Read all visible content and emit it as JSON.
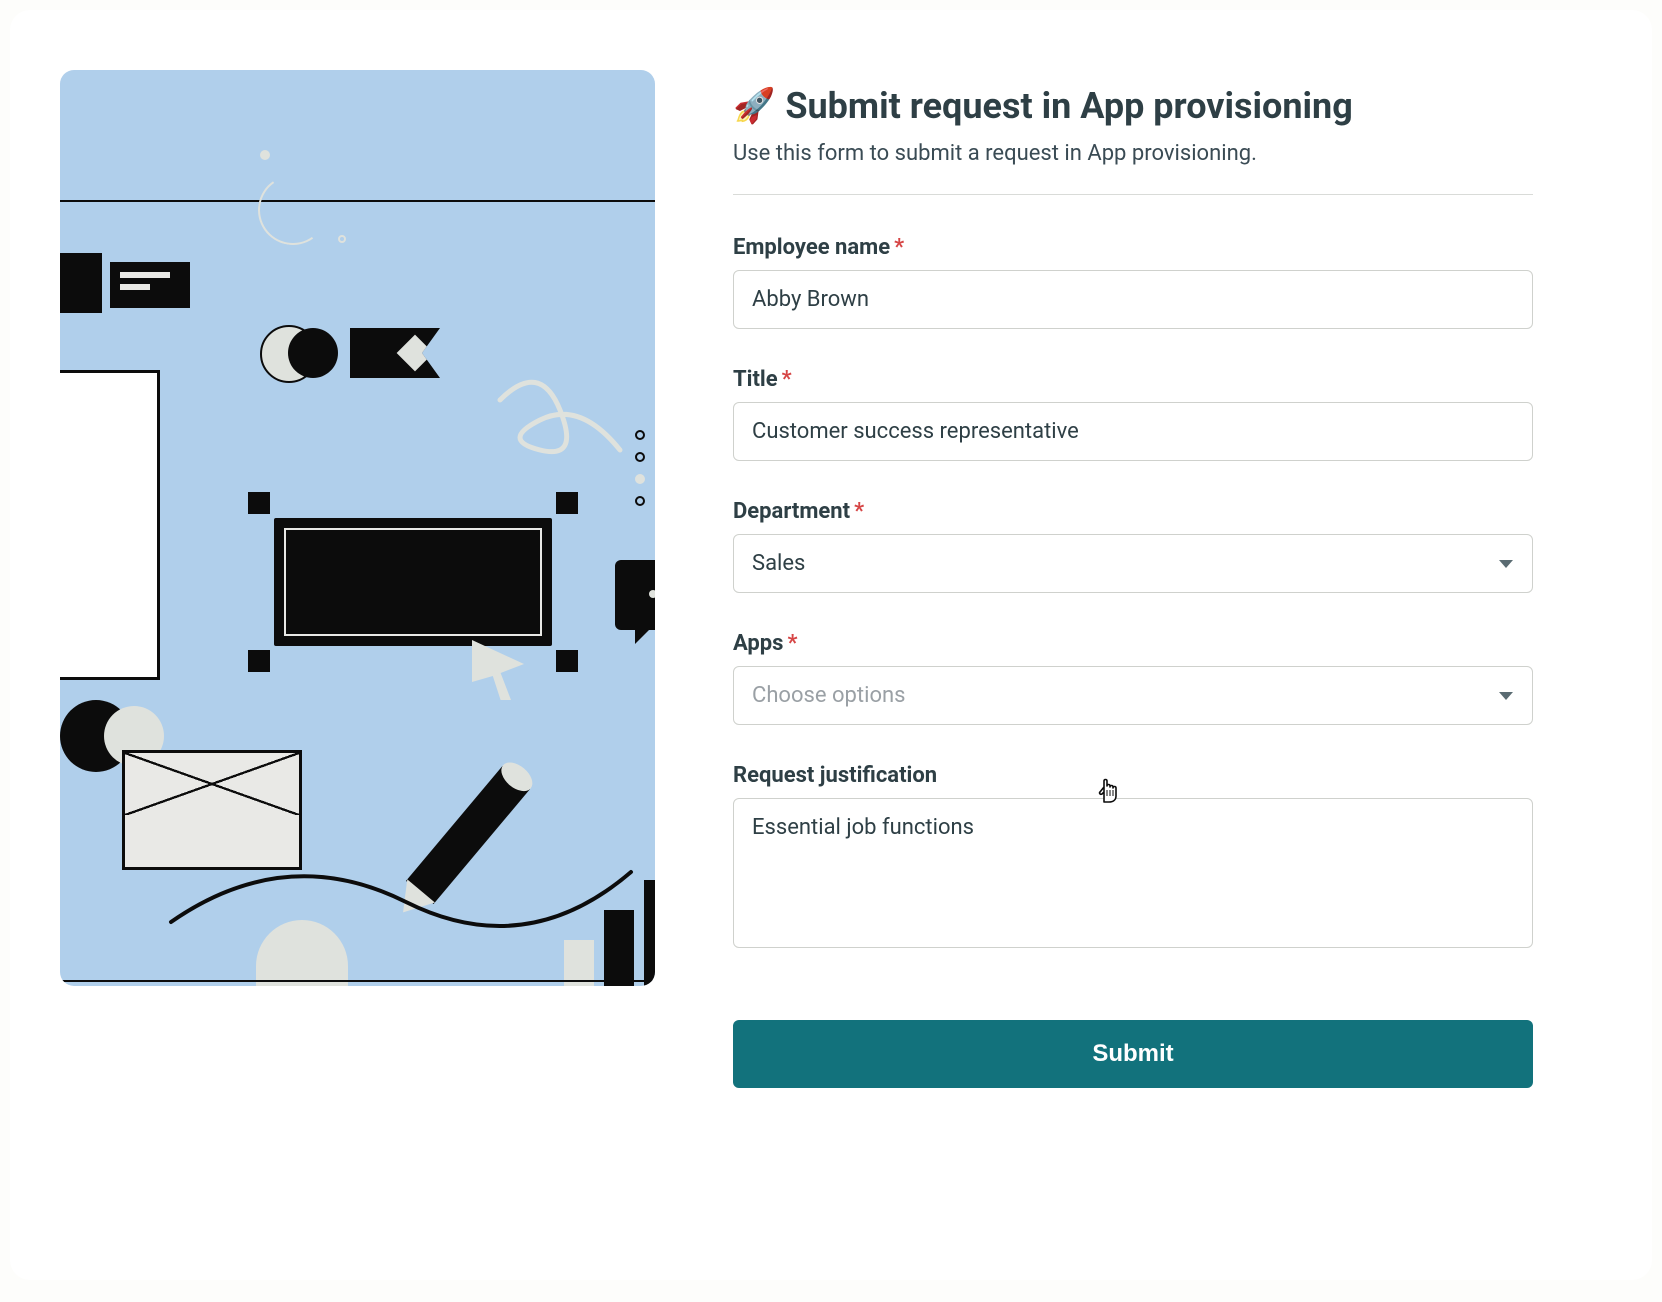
{
  "header": {
    "emoji": "🚀",
    "title": "Submit request in App provisioning",
    "subtitle": "Use this form to submit a request in App provisioning."
  },
  "fields": {
    "employee_name": {
      "label": "Employee name",
      "required": true,
      "value": "Abby Brown"
    },
    "title": {
      "label": "Title",
      "required": true,
      "value": "Customer success representative"
    },
    "department": {
      "label": "Department",
      "required": true,
      "value": "Sales"
    },
    "apps": {
      "label": "Apps",
      "required": true,
      "placeholder": "Choose options",
      "value": ""
    },
    "justification": {
      "label": "Request justification",
      "required": false,
      "value": "Essential job functions"
    }
  },
  "submit_label": "Submit",
  "required_mark": "*"
}
